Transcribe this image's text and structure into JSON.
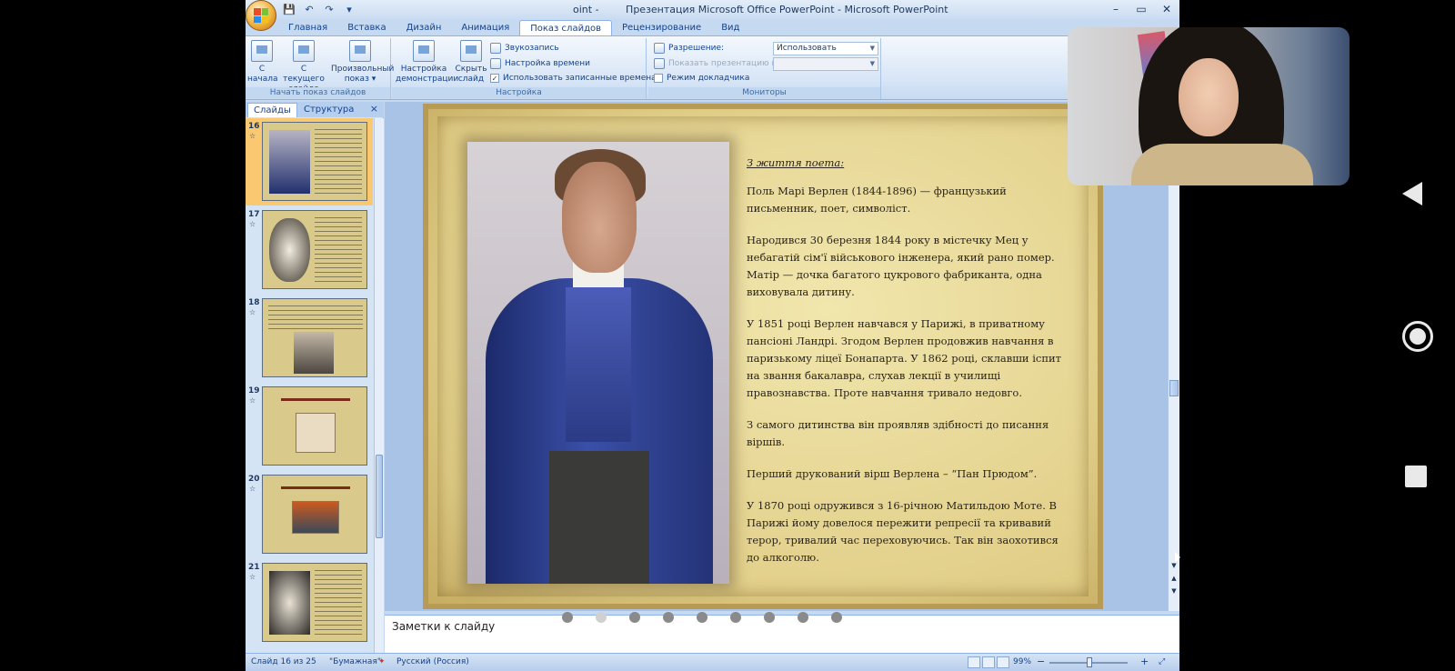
{
  "window": {
    "title_fragment": "oint -",
    "title": "Презентация Microsoft Office PowerPoint - Microsoft PowerPoint",
    "controls": [
      "–",
      "▭",
      "✕"
    ]
  },
  "quick_access": {
    "save": "💾",
    "undo": "↶",
    "redo": "↷",
    "more": "▾"
  },
  "ribbon_tabs": [
    "Главная",
    "Вставка",
    "Дизайн",
    "Анимация",
    "Показ слайдов",
    "Рецензирование",
    "Вид"
  ],
  "active_tab": "Показ слайдов",
  "ribbon": {
    "start_group": {
      "label": "Начать показ слайдов",
      "from_beginning": [
        "С",
        "начала"
      ],
      "from_current": [
        "С текущего",
        "слайда"
      ],
      "custom": [
        "Произвольный",
        "показ ▾"
      ]
    },
    "setup_group": {
      "label": "Настройка",
      "setup_show": [
        "Настройка",
        "демонстрации"
      ],
      "hide_slide": [
        "Скрыть",
        "слайд"
      ],
      "record": "Звукозапись",
      "rehearse": "Настройка времени",
      "use_timings": "Использовать записанные времена"
    },
    "monitors_group": {
      "label": "Мониторы",
      "resolution_label": "Разрешение:",
      "resolution_value": "Использовать текуще...",
      "show_on_label": "Показать презентацию на:",
      "presenter_view": "Режим докладчика"
    }
  },
  "left_pane": {
    "tab_slides": "Слайды",
    "tab_outline": "Структура",
    "close": "×",
    "thumbnails": [
      {
        "num": "16",
        "selected": true
      },
      {
        "num": "17",
        "selected": false
      },
      {
        "num": "18",
        "selected": false
      },
      {
        "num": "19",
        "selected": false
      },
      {
        "num": "20",
        "selected": false
      },
      {
        "num": "21",
        "selected": false
      }
    ],
    "star": "☆"
  },
  "slide": {
    "heading": "З життя поета:",
    "paragraphs": [
      "Поль Марі Верлен (1844-1896) — французький письменник, поет, символіст.",
      " Народився 30 березня 1844 року в містечку Мец у небагатій сім'ї військового інженера, який рано помер. Матір — дочка багатого цукрового фабриканта, одна виховувала дитину.",
      "У 1851 році Верлен навчався у Парижі, в приватному пансіоні Ландрі. Згодом Верлен продовжив навчання в паризькому ліцеї Бонапарта. У 1862 році, склавши іспит на звання бакалавра, слухав лекції в училищі правознавства. Проте навчання тривало недовго.",
      "З самого дитинства він проявляв здібності до писання віршів.",
      "Перший друкований вірш Верлена – “Пан Прюдом”.",
      "У 1870 році одружився з 16-річною Матильдою Моте. В Парижі йому довелося пережити репресії та кривавий терор, тривалий час переховуючись. Так він заохотився до алкоголю."
    ]
  },
  "notes": {
    "placeholder": "Заметки к слайду",
    "page_dots": 9,
    "active_dot": 2
  },
  "status_bar": {
    "slide_info": "Слайд 16 из 25",
    "theme": "\"Бумажная\"",
    "language": "Русский (Россия)",
    "zoom": "99%",
    "zoom_minus": "−",
    "zoom_plus": "+"
  },
  "colors": {
    "ribbon_accent": "#15428b",
    "selected_thumb": "#f9c870",
    "slide_paper": "#e3d18b"
  }
}
